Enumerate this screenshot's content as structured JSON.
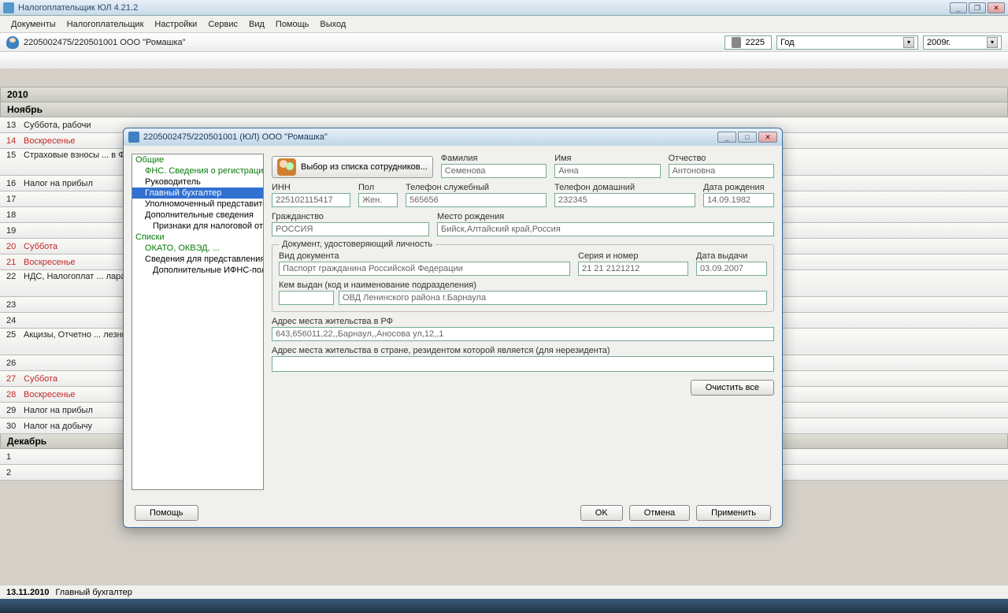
{
  "app": {
    "title": "Налогоплательщик ЮЛ 4.21.2"
  },
  "menu": {
    "documents": "Документы",
    "taxpayer": "Налогоплательщик",
    "settings": "Настройки",
    "service": "Сервис",
    "view": "Вид",
    "help": "Помощь",
    "exit": "Выход"
  },
  "header": {
    "org": "2205002475/220501001 ООО \"Ромашка\"",
    "code": "2225",
    "period": "Год",
    "year": "2009г."
  },
  "grid": {
    "year": "2010",
    "month1": "Ноябрь",
    "month2": "Декабрь",
    "days": [
      {
        "n": "13",
        "t": "Суббота, рабочи",
        "we": false
      },
      {
        "n": "14",
        "t": "Воскресенье",
        "we": true
      },
      {
        "n": "15",
        "t": "Страховые взносы ... в Фонд социального страхования Российской, Федераци",
        "we": false,
        "tall": true
      },
      {
        "n": "16",
        "t": "Налог на прибыл",
        "we": false
      },
      {
        "n": "17",
        "t": "",
        "we": false
      },
      {
        "n": "18",
        "t": "",
        "we": false
      },
      {
        "n": "19",
        "t": "",
        "we": false
      },
      {
        "n": "20",
        "t": "Суббота",
        "we": true
      },
      {
        "n": "21",
        "t": "Воскресенье",
        "we": true
      },
      {
        "n": "22",
        "t": "НДС, Налогоплат ... ларацию и, Сбор за пользование объектами водных би",
        "we": false,
        "tall": true
      },
      {
        "n": "23",
        "t": "",
        "we": false
      },
      {
        "n": "24",
        "t": "",
        "we": false
      },
      {
        "n": "25",
        "t": "Акцизы, Отчетно ... лезных ископаемых, Налогоплательщики уплачивают налог за",
        "we": false,
        "tall": true
      },
      {
        "n": "26",
        "t": "",
        "we": false
      },
      {
        "n": "27",
        "t": "Суббота",
        "we": true
      },
      {
        "n": "28",
        "t": "Воскресенье",
        "we": true
      },
      {
        "n": "29",
        "t": "Налог на прибыл",
        "we": false
      },
      {
        "n": "30",
        "t": "Налог на добычу",
        "we": false
      }
    ],
    "dec": [
      {
        "n": "1",
        "t": ""
      },
      {
        "n": "2",
        "t": ""
      }
    ]
  },
  "status": {
    "date": "13.11.2010",
    "role": "Главный бухгалтер"
  },
  "dialog": {
    "title": "2205002475/220501001 (ЮЛ) ООО \"Ромашка\"",
    "tree": {
      "general": "Общие",
      "fns": "ФНС. Сведения о регистрации",
      "head": "Руководитель",
      "chief": "Главный бухгалтер",
      "rep": "Уполномоченный представител",
      "extra": "Дополнительные сведения",
      "signs": "Признаки для налоговой отч",
      "lists": "Списки",
      "okato": "ОКАТО, ОКВЭД, ...",
      "sved": "Сведения для представления в",
      "dop": "Дополнительные ИФНС-пол"
    },
    "emp_btn": "Выбор из списка сотрудников...",
    "labels": {
      "surname": "Фамилия",
      "name": "Имя",
      "patr": "Отчество",
      "inn": "ИНН",
      "sex": "Пол",
      "wphone": "Телефон служебный",
      "hphone": "Телефон домашний",
      "bdate": "Дата рождения",
      "citizen": "Гражданство",
      "bplace": "Место рождения",
      "docsection": "Документ, удостоверяющий личность",
      "doctype": "Вид документа",
      "docnum": "Серия и номер",
      "docdate": "Дата выдачи",
      "docissuer": "Кем выдан (код и наименование подразделения)",
      "addr_rf": "Адрес места жительства в РФ",
      "addr_nr": "Адрес места жительства в стране, резидентом которой является (для нерезидента)"
    },
    "values": {
      "surname": "Семенова",
      "name": "Анна",
      "patr": "Антоновна",
      "inn": "225102115417",
      "sex": "Жен.",
      "wphone": "565656",
      "hphone": "232345",
      "bdate": "14.09.1982",
      "citizen": "РОССИЯ",
      "bplace": "Бийск,Алтайский край,Россия",
      "doctype": "Паспорт гражданина Российской Федерации",
      "docnum": "21 21 2121212",
      "docdate": "03.09.2007",
      "docissuer_code": "",
      "docissuer": "ОВД Ленинского района г.Барнаула",
      "addr_rf": "643,656011,22,,Барнаул,,Аносова ул,12,,1",
      "addr_nr": ""
    },
    "buttons": {
      "clear": "Очистить все",
      "help": "Помощь",
      "ok": "OK",
      "cancel": "Отмена",
      "apply": "Применить"
    }
  }
}
